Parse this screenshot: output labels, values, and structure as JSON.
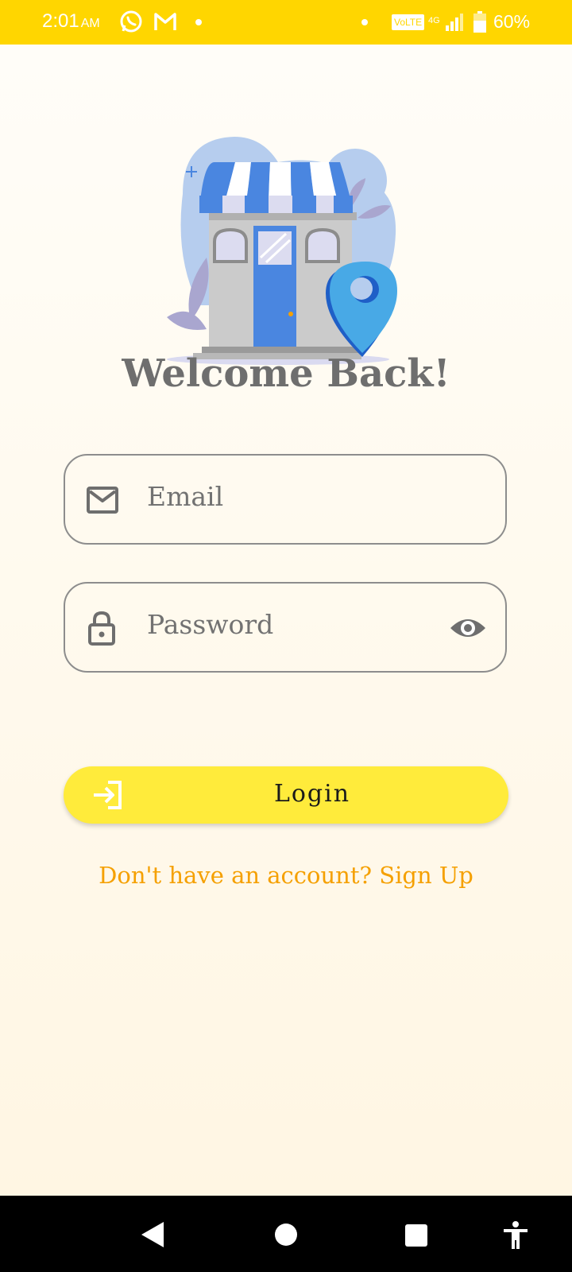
{
  "status_bar": {
    "time": "2:01",
    "ampm": "AM",
    "left_icons": [
      "whatsapp-icon",
      "gmail-icon",
      "dot"
    ],
    "volte": "VoLTE",
    "network": "4G",
    "battery": "60%"
  },
  "illustration": {
    "icon": "storefront-location-illustration"
  },
  "title": "Welcome Back!",
  "email": {
    "placeholder": "Email",
    "icon": "mail-icon"
  },
  "password": {
    "placeholder": "Password",
    "icon": "lock-icon",
    "toggle_icon": "eye-icon"
  },
  "login": {
    "label": "Login",
    "icon": "login-icon"
  },
  "signup_link": "Don't have an account? Sign Up",
  "nav": [
    "back-icon",
    "home-icon",
    "recents-icon",
    "accessibility-icon"
  ],
  "colors": {
    "status_bar": "#ffd600",
    "button": "#ffeb3b",
    "link": "#f5a000",
    "title": "#6e6e6e",
    "field_border": "#8d8d8d"
  }
}
